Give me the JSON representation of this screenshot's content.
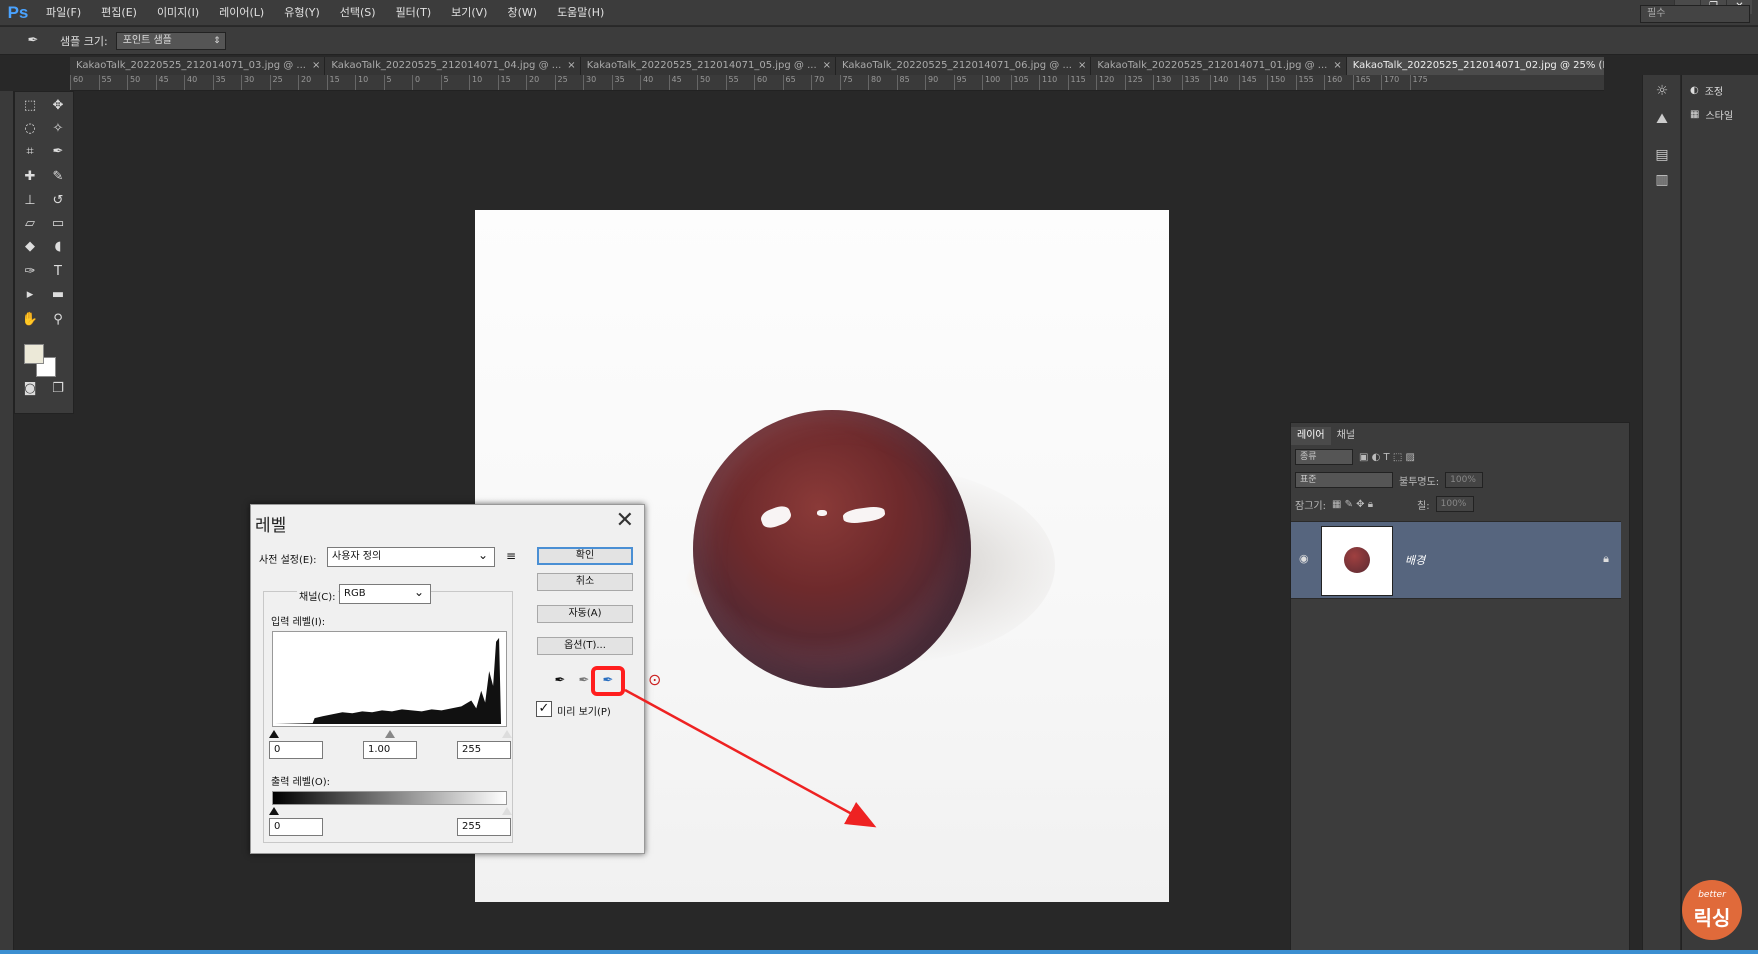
{
  "app": {
    "logo": "Ps"
  },
  "menu": [
    "파일(F)",
    "편집(E)",
    "이미지(I)",
    "레이어(L)",
    "유형(Y)",
    "선택(S)",
    "필터(T)",
    "보기(V)",
    "창(W)",
    "도움말(H)"
  ],
  "window_controls": {
    "minimize": "—",
    "restore": "❐",
    "close": "✕"
  },
  "options_bar": {
    "sample_label": "샘플 크기:",
    "sample_value": "포인트 샘플",
    "workspace": "필수"
  },
  "tabs": [
    {
      "label": "KakaoTalk_20220525_212014071_03.jpg @ ...",
      "active": false
    },
    {
      "label": "KakaoTalk_20220525_212014071_04.jpg @ ...",
      "active": false
    },
    {
      "label": "KakaoTalk_20220525_212014071_05.jpg @ ...",
      "active": false
    },
    {
      "label": "KakaoTalk_20220525_212014071_06.jpg @ ...",
      "active": false
    },
    {
      "label": "KakaoTalk_20220525_212014071_01.jpg @ ...",
      "active": false
    },
    {
      "label": "KakaoTalk_20220525_212014071_02.jpg @ 25% (RGB/8) *",
      "active": true
    }
  ],
  "ruler_ticks": [
    "60",
    "55",
    "50",
    "45",
    "40",
    "35",
    "30",
    "25",
    "20",
    "15",
    "10",
    "5",
    "0",
    "5",
    "10",
    "15",
    "20",
    "25",
    "30",
    "35",
    "40",
    "45",
    "50",
    "55",
    "60",
    "65",
    "70",
    "75",
    "80",
    "85",
    "90",
    "95",
    "100",
    "105",
    "110",
    "115",
    "120",
    "125",
    "130",
    "135",
    "140",
    "145",
    "150",
    "155",
    "160",
    "165",
    "170",
    "175"
  ],
  "dock": {
    "adjust": "조정",
    "styles": "스타일"
  },
  "layers_panel": {
    "tabs": [
      "레이어",
      "채널"
    ],
    "kind": "종류",
    "blend_mode": "표준",
    "opacity_label": "불투명도:",
    "opacity_value": "100%",
    "lock_label": "잠그기:",
    "fill_label": "칠:",
    "fill_value": "100%",
    "layer_name": "배경"
  },
  "levels_dialog": {
    "title": "레벨",
    "close": "✕",
    "preset_label": "사전 설정(E):",
    "preset_value": "사용자 정의",
    "channel_label": "채널(C):",
    "channel_value": "RGB",
    "input_levels_label": "입력 레벨(I):",
    "input_black": "0",
    "input_gamma": "1.00",
    "input_white": "255",
    "output_levels_label": "출력 레벨(O):",
    "output_black": "0",
    "output_white": "255",
    "btn_ok": "확인",
    "btn_cancel": "취소",
    "btn_auto": "자동(A)",
    "btn_options": "옵션(T)...",
    "preview_label": "미리 보기(P)",
    "preview_checked": "✓"
  },
  "watermark": {
    "small": "better",
    "big": "릭싱"
  },
  "colors": {
    "accent_highlight": "#ff1e1e",
    "arrow": "#ee2222",
    "layer_selected": "#56657e"
  }
}
